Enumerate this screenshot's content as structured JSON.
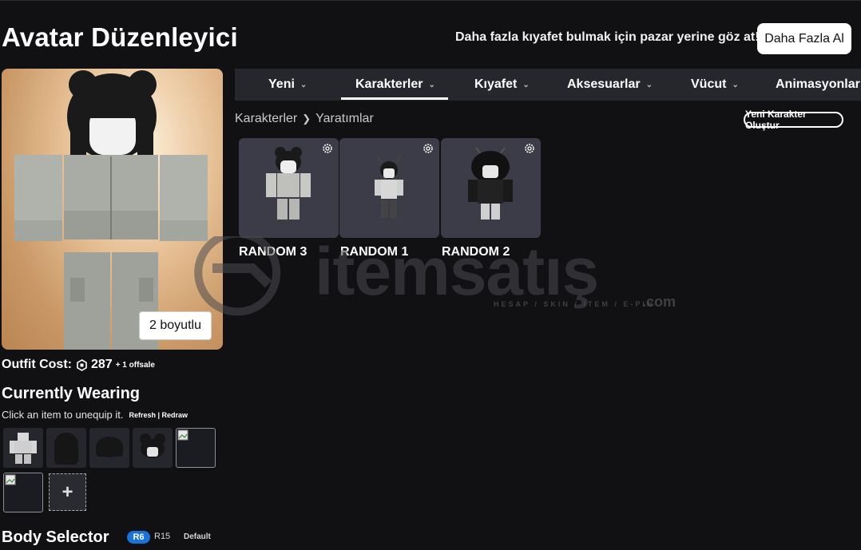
{
  "header": {
    "title": "Avatar Düzenleyici",
    "promo_text": "Daha fazla kıyafet bulmak için pazar yerine göz at!",
    "more_button": "Daha Fazla Al"
  },
  "preview": {
    "dimension_button": "2 boyutlu"
  },
  "tabs": [
    {
      "label": "Yeni",
      "active": false
    },
    {
      "label": "Karakterler",
      "active": true
    },
    {
      "label": "Kıyafet",
      "active": false
    },
    {
      "label": "Aksesuarlar",
      "active": false
    },
    {
      "label": "Vücut",
      "active": false
    },
    {
      "label": "Animasyonlar",
      "active": false
    }
  ],
  "breadcrumb": {
    "root": "Karakterler",
    "current": "Yaratımlar"
  },
  "new_character_button": "Yeni Karakter Oluştur",
  "characters": [
    {
      "name": "RANDOM 3"
    },
    {
      "name": "RANDOM 1"
    },
    {
      "name": "RANDOM 2"
    }
  ],
  "watermark": {
    "brand": "itemsatış",
    "tagline": "HESAP / SKIN / ITEM / E-PIN",
    "suffix": ".com"
  },
  "outfit": {
    "cost_label": "Outfit Cost:",
    "cost_value": "287",
    "offsale": "+ 1 offsale"
  },
  "currently_wearing": {
    "title": "Currently Wearing",
    "hint": "Click an item to unequip it.",
    "links": "Refresh | Redraw",
    "items": [
      "clothing-item",
      "long-hair",
      "bob-hair",
      "bun-hair",
      "broken-image",
      "broken-image"
    ],
    "add_label": "+"
  },
  "body_selector": {
    "title": "Body Selector",
    "options": [
      "R6",
      "R15",
      "Default"
    ],
    "selected": "R6"
  },
  "colors": {
    "background": "#111114",
    "tabbar": "#26272d",
    "card": "#3b3c47",
    "accent": "#1b72d9"
  }
}
